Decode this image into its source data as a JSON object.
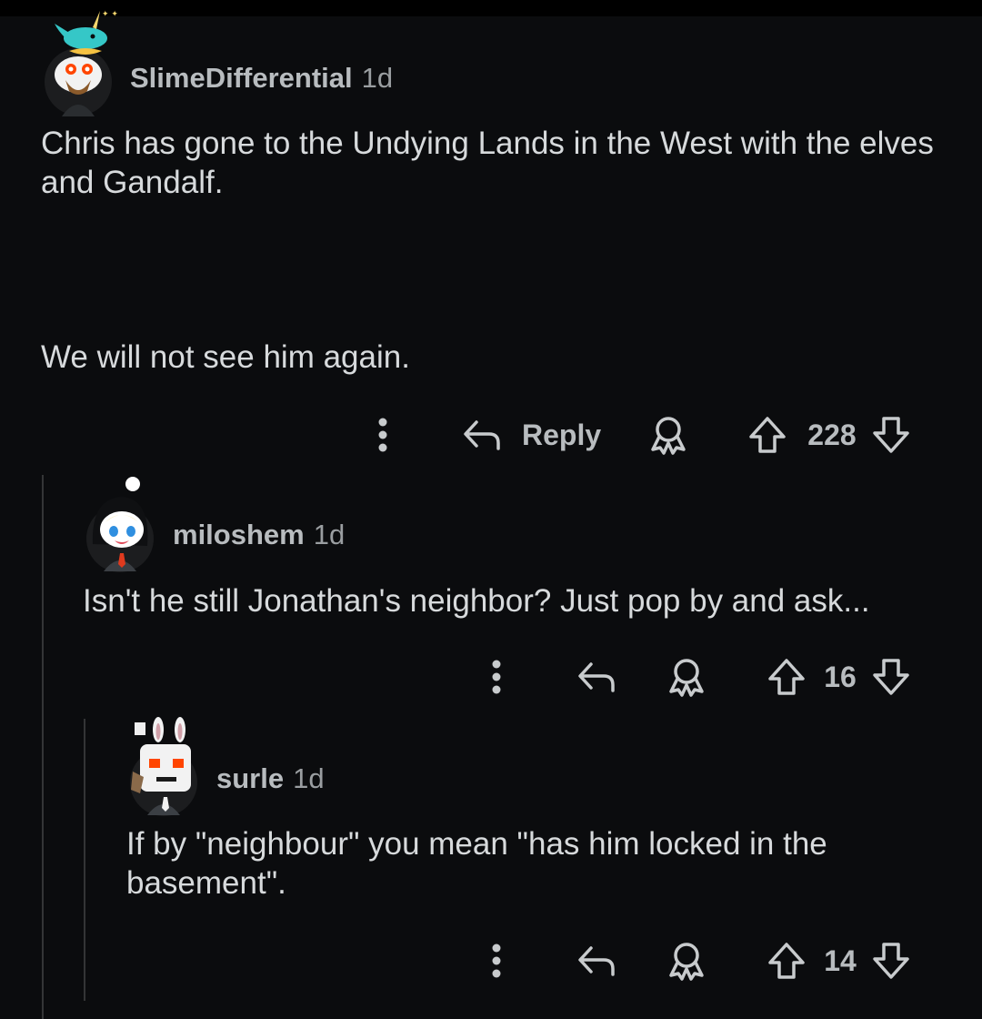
{
  "comments": [
    {
      "username": "SlimeDifferential",
      "time": "1d",
      "paragraphs": [
        "Chris has gone to the Undying Lands in the West with the elves and Gandalf.",
        "We will not see him again."
      ],
      "reply_label": "Reply",
      "votes": "228"
    },
    {
      "username": "miloshem",
      "time": "1d",
      "paragraphs": [
        "Isn't he still Jonathan's neighbor? Just pop by and ask..."
      ],
      "votes": "16"
    },
    {
      "username": "surle",
      "time": "1d",
      "paragraphs": [
        "If by \"neighbour\" you mean \"has him locked in the basement\"."
      ],
      "votes": "14"
    }
  ],
  "icons": {
    "more": "vertical-dots-icon",
    "reply": "reply-arrow-icon",
    "award": "award-icon",
    "upvote": "upvote-arrow-icon",
    "downvote": "downvote-arrow-icon"
  },
  "colors": {
    "background": "#0b0c0e",
    "text": "#d7dadc",
    "muted": "#b8bcbf",
    "thread_line": "#343536"
  }
}
